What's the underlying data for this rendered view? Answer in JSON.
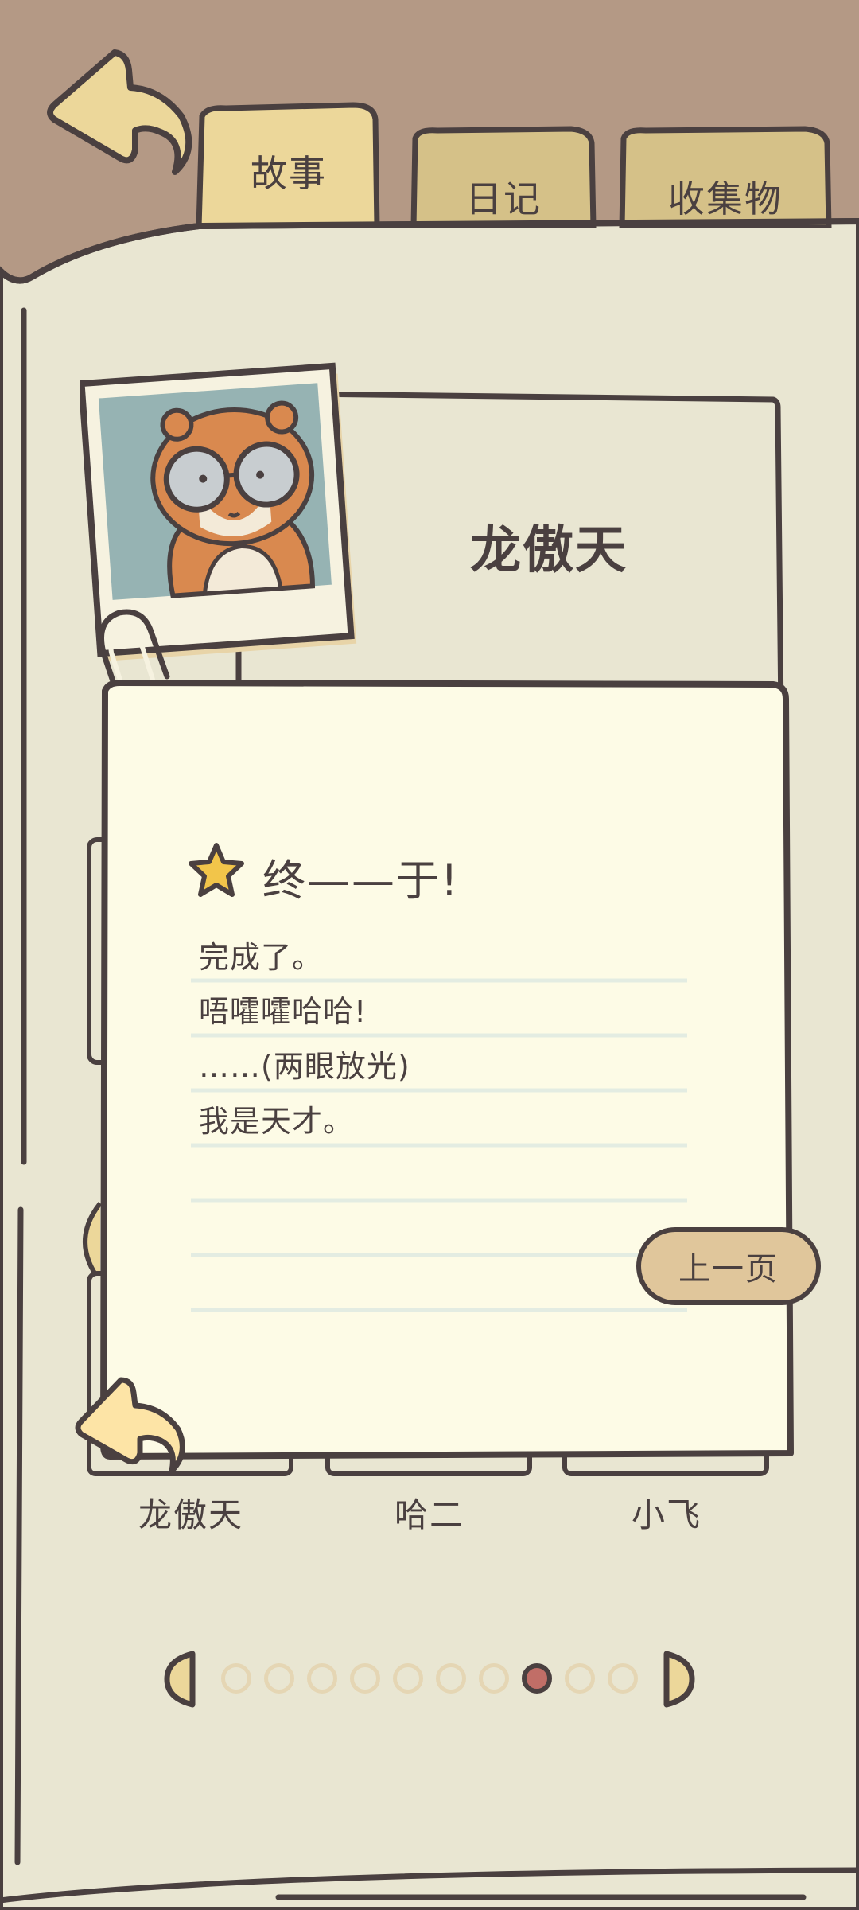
{
  "tabs": [
    {
      "label": "故事"
    },
    {
      "label": "日记"
    },
    {
      "label": "收集物"
    }
  ],
  "character": {
    "name": "龙傲天"
  },
  "note": {
    "title": "终——于!",
    "lines": [
      "完成了。",
      "唔嚯嚯哈哈!",
      "……(两眼放光)",
      "我是天才。"
    ]
  },
  "prev_page_label": "上一页",
  "character_tabs": [
    {
      "label": "龙傲天"
    },
    {
      "label": "哈二"
    },
    {
      "label": "小飞"
    }
  ],
  "pagination": {
    "total_pages": 10,
    "current_page": 8
  },
  "colors": {
    "background_brown": "#b49985",
    "paper": "#e9e6d2",
    "note_paper": "#fdfbe6",
    "tab_yellow": "#ecd79a",
    "tab_yellow_dark": "#d5c188",
    "outline": "#4a4040",
    "active_dot": "#c16e67",
    "button": "#e0c69b"
  }
}
